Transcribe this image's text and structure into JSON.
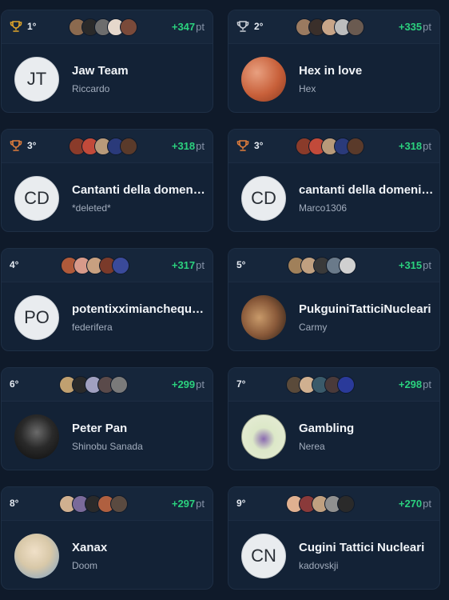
{
  "points_unit": "pt",
  "colors": {
    "background": "#0f1a2a",
    "card": "#132236",
    "points": "#2bd17e",
    "gold": "#e0a52a",
    "silver": "#c9ced6",
    "bronze": "#e07d3c"
  },
  "teams": [
    {
      "rank": "1°",
      "trophy": "gold",
      "points": "+347",
      "initials": "JT",
      "name": "Jaw Team",
      "owner": "Riccardo",
      "avatar": "initials",
      "members": [
        "#8b6a4f",
        "#2a2a2a",
        "#6d6d6d",
        "#e6d8cc",
        "#7a4a3a"
      ]
    },
    {
      "rank": "2°",
      "trophy": "silver",
      "points": "+335",
      "initials": "",
      "name": "Hex in love",
      "owner": "Hex",
      "avatar": "photo-hex",
      "members": [
        "#9a7a60",
        "#3a2f2a",
        "#c8a588",
        "#bdbdbd",
        "#6a5a50"
      ]
    },
    {
      "rank": "3°",
      "trophy": "bronze",
      "points": "+318",
      "initials": "CD",
      "name": "Cantanti della domenica",
      "owner": "*deleted*",
      "avatar": "initials",
      "members": [
        "#8a3b2a",
        "#c24a3a",
        "#b89a7a",
        "#2a3a7a",
        "#5a3a2a"
      ]
    },
    {
      "rank": "3°",
      "trophy": "bronze",
      "points": "+318",
      "initials": "CD",
      "name": "cantanti della domenica",
      "owner": "Marco1306",
      "avatar": "initials",
      "members": [
        "#8a3b2a",
        "#c24a3a",
        "#b89a7a",
        "#2a3a7a",
        "#5a3a2a"
      ]
    },
    {
      "rank": "4°",
      "trophy": "",
      "points": "+317",
      "initials": "PO",
      "name": "potentixximianchequest",
      "owner": "federifera",
      "avatar": "initials",
      "members": [
        "#b05a3a",
        "#d89a8a",
        "#c8a080",
        "#7a3a2a",
        "#3a4a9a"
      ]
    },
    {
      "rank": "5°",
      "trophy": "",
      "points": "+315",
      "initials": "",
      "name": "PukguiniTatticiNucleari",
      "owner": "Carmy",
      "avatar": "photo-camel",
      "members": [
        "#a0805a",
        "#c0a080",
        "#3a3a3a",
        "#6a7a8a",
        "#d0d0d0"
      ]
    },
    {
      "rank": "6°",
      "trophy": "",
      "points": "+299",
      "initials": "",
      "name": "Peter Pan",
      "owner": "Shinobu Sanada",
      "avatar": "photo-dark",
      "members": [
        "#c0a070",
        "#2a2a2a",
        "#a0a0c0",
        "#5a4a4a",
        "#7a7a7a"
      ]
    },
    {
      "rank": "7°",
      "trophy": "",
      "points": "+298",
      "initials": "",
      "name": "Gambling",
      "owner": "Nerea",
      "avatar": "photo-gambling",
      "members": [
        "#5a4a3a",
        "#d0b090",
        "#3a5a6a",
        "#4a3a3a",
        "#2a3a9a"
      ]
    },
    {
      "rank": "8°",
      "trophy": "",
      "points": "+297",
      "initials": "",
      "name": "Xanax",
      "owner": "Doom",
      "avatar": "photo-anime",
      "members": [
        "#d0b090",
        "#7a6a9a",
        "#2a2a2a",
        "#b06040",
        "#5a4a40"
      ]
    },
    {
      "rank": "9°",
      "trophy": "",
      "points": "+270",
      "initials": "CN",
      "name": "Cugini Tattici Nucleari",
      "owner": "kadovskji",
      "avatar": "initials",
      "members": [
        "#e0b090",
        "#8a3a3a",
        "#c0a080",
        "#909090",
        "#2a2a2a"
      ]
    }
  ]
}
